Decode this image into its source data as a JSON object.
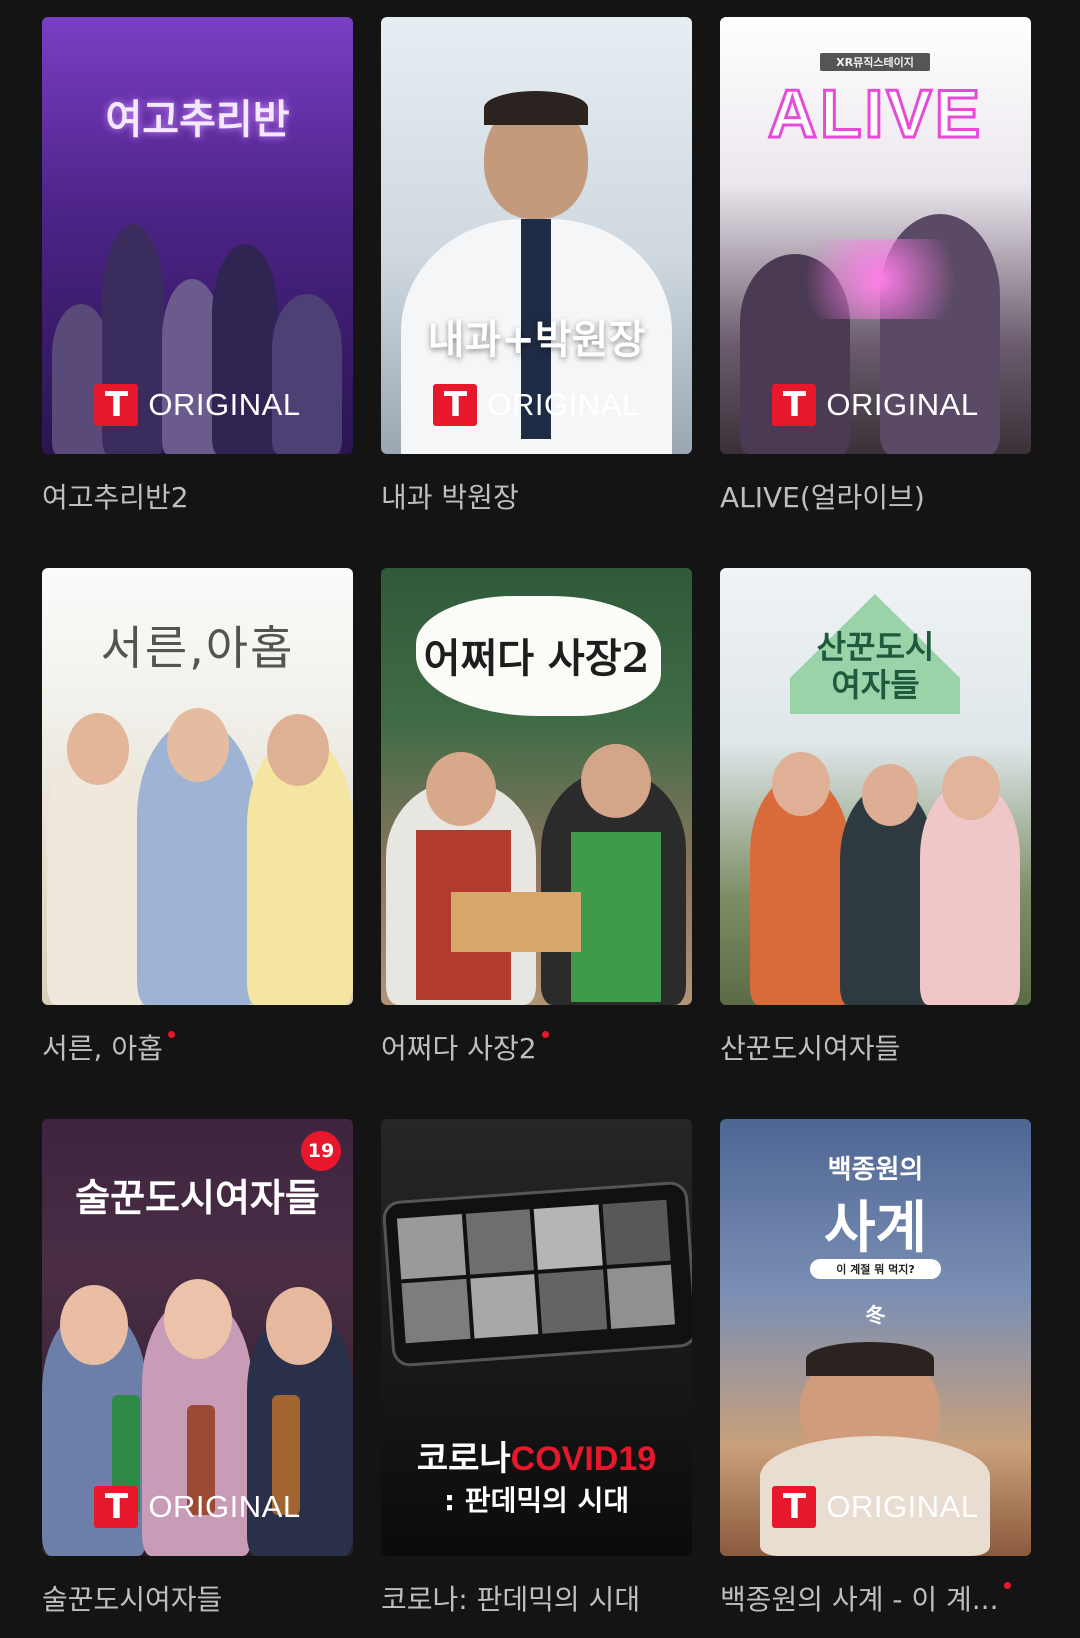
{
  "grid": {
    "items": [
      {
        "caption": "여고추리반2",
        "new": false,
        "poster": {
          "title": "여고추리반",
          "badge": "ORIGINAL"
        },
        "colors": {
          "bg_top": "#5a2aa0",
          "bg_bottom": "#2a1550",
          "accent": "#c9a7ff"
        }
      },
      {
        "caption": "내과 박원장",
        "new": false,
        "poster": {
          "title": "내과+박원장",
          "badge": "ORIGINAL"
        },
        "colors": {
          "bg_top": "#dfe8ee",
          "bg_bottom": "#a9b7c1",
          "accent": "#ffffff"
        }
      },
      {
        "caption": "ALIVE(얼라이브)",
        "new": false,
        "poster": {
          "kicker": "XR뮤직스테이지",
          "title": "ALIVE",
          "badge": "ORIGINAL"
        },
        "colors": {
          "bg_top": "#ffffff",
          "bg_bottom": "#4b3f4c",
          "accent": "#e64bd8"
        }
      },
      {
        "caption": "서른, 아홉",
        "new": true,
        "poster": {
          "title": "서른,아홉"
        },
        "colors": {
          "bg_top": "#f7f7f5",
          "bg_bottom": "#eae3d2",
          "accent": "#555550"
        }
      },
      {
        "caption": "어쩌다 사장2",
        "new": true,
        "poster": {
          "title": "어쩌다 사장2"
        },
        "colors": {
          "bg_top": "#2f5a3a",
          "bg_bottom": "#9a7b63",
          "accent": "#1d1d1d"
        }
      },
      {
        "caption": "산꾼도시여자들",
        "new": false,
        "poster": {
          "title": "산꾼도시 여자들"
        },
        "colors": {
          "bg_top": "#e9eef0",
          "bg_bottom": "#6c7f58",
          "accent": "#1f5a3e"
        }
      },
      {
        "caption": "술꾼도시여자들",
        "new": false,
        "poster": {
          "title": "술꾼도시여자들",
          "badge": "ORIGINAL",
          "age_rating": "19"
        },
        "colors": {
          "bg_top": "#3e2440",
          "bg_bottom": "#2b1b22",
          "accent": "#ffffff"
        }
      },
      {
        "caption": "코로나: 판데믹의 시대",
        "new": false,
        "poster": {
          "title_a": "코로나",
          "title_b": "COVID19",
          "subtitle": ": 판데믹의 시대"
        },
        "colors": {
          "bg_top": "#1e1e1e",
          "bg_bottom": "#0b0b0b",
          "accent": "#e7182c"
        }
      },
      {
        "caption": "백종원의 사계 - 이 계...",
        "new": true,
        "poster": {
          "kicker": "백종원의",
          "title": "사계",
          "subtitle": "이 계절 뭐 먹지?",
          "mark": "冬",
          "badge": "ORIGINAL"
        },
        "colors": {
          "bg_top": "#5d73a3",
          "bg_bottom": "#c98a5c",
          "accent": "#ffffff"
        }
      }
    ]
  }
}
